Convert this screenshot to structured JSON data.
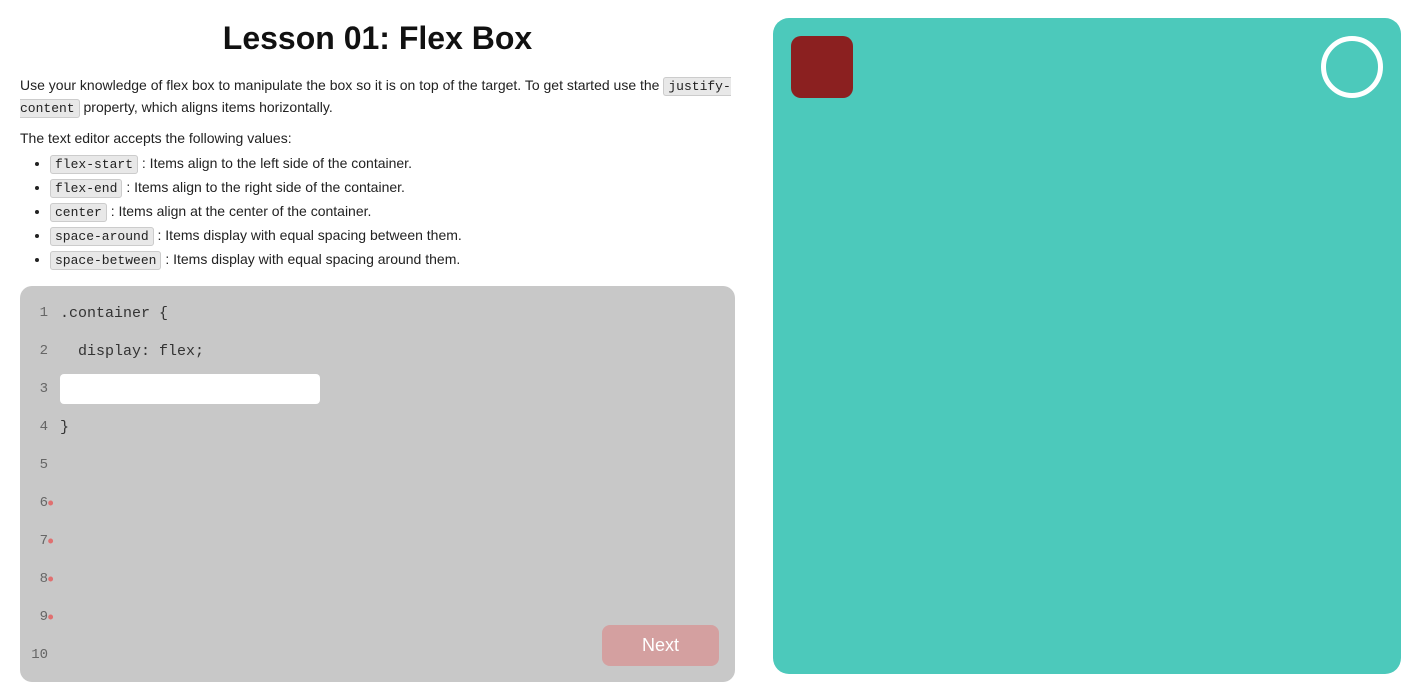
{
  "lesson": {
    "title": "Lesson 01: Flex Box",
    "intro": "Use your knowledge of flex box to manipulate the box so it is on top of the target. To get started use the",
    "intro_property": "justify-content",
    "intro_suffix": " property, which aligns items horizontally.",
    "values_heading": "The text editor accepts the following values:",
    "values": [
      {
        "keyword": "flex-start",
        "description": ": Items align to the left side of the container."
      },
      {
        "keyword": "flex-end",
        "description": ": Items align to the right side of the container."
      },
      {
        "keyword": "center",
        "description": ": Items align at the center of the container."
      },
      {
        "keyword": "space-around",
        "description": ": Items display with equal spacing between them."
      },
      {
        "keyword": "space-between",
        "description": ": Items display with equal spacing around them."
      }
    ],
    "code_lines": [
      {
        "number": "1",
        "content": ".container {",
        "type": "text",
        "dot": false
      },
      {
        "number": "2",
        "content": "  display: flex;",
        "type": "text",
        "dot": false
      },
      {
        "number": "3",
        "content": "",
        "type": "input",
        "dot": false
      },
      {
        "number": "4",
        "content": "}",
        "type": "text",
        "dot": false
      },
      {
        "number": "5",
        "content": "",
        "type": "text",
        "dot": false
      },
      {
        "number": "6",
        "content": "",
        "type": "text",
        "dot": true
      },
      {
        "number": "7",
        "content": "",
        "type": "text",
        "dot": true
      },
      {
        "number": "8",
        "content": "",
        "type": "text",
        "dot": true
      },
      {
        "number": "9",
        "content": "",
        "type": "text",
        "dot": true
      },
      {
        "number": "10",
        "content": "",
        "type": "text",
        "dot": false
      }
    ],
    "next_button_label": "Next",
    "input_placeholder": ""
  },
  "colors": {
    "teal": "#4cc9bb",
    "dark_red": "#8b2020",
    "editor_bg": "#c8c8c8",
    "next_btn": "#d4a0a0"
  }
}
